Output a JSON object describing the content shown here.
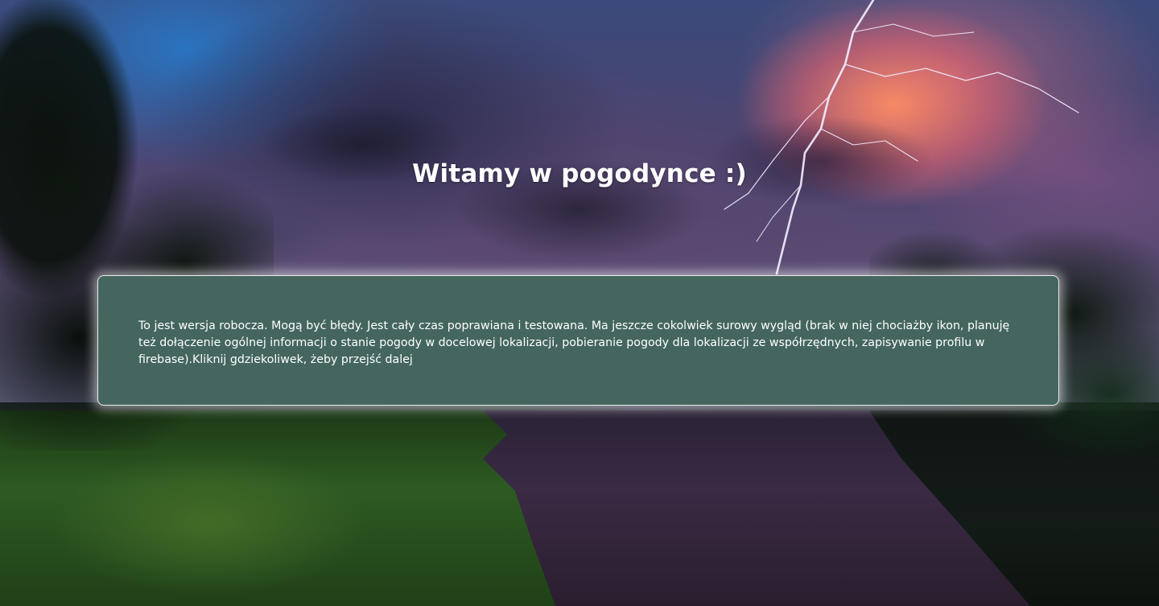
{
  "page": {
    "title": "Witamy w pogodynce :)",
    "notice": "To jest wersja robocza. Mogą być błędy. Jest cały czas poprawiana i testowana. Ma jeszcze cokolwiek surowy wygląd (brak w niej chociażby ikon, planuję też dołączenie ogólnej informacji o stanie pogody w docelowej lokalizacji, pobieranie pogody dla lokalizacji ze współrzędnych, zapisywanie profilu w firebase).Kliknij gdziekoliwek, żeby przejść dalej"
  },
  "colors": {
    "card_background": "#44665f",
    "card_border": "#e8ecea",
    "text": "#ffffff"
  }
}
